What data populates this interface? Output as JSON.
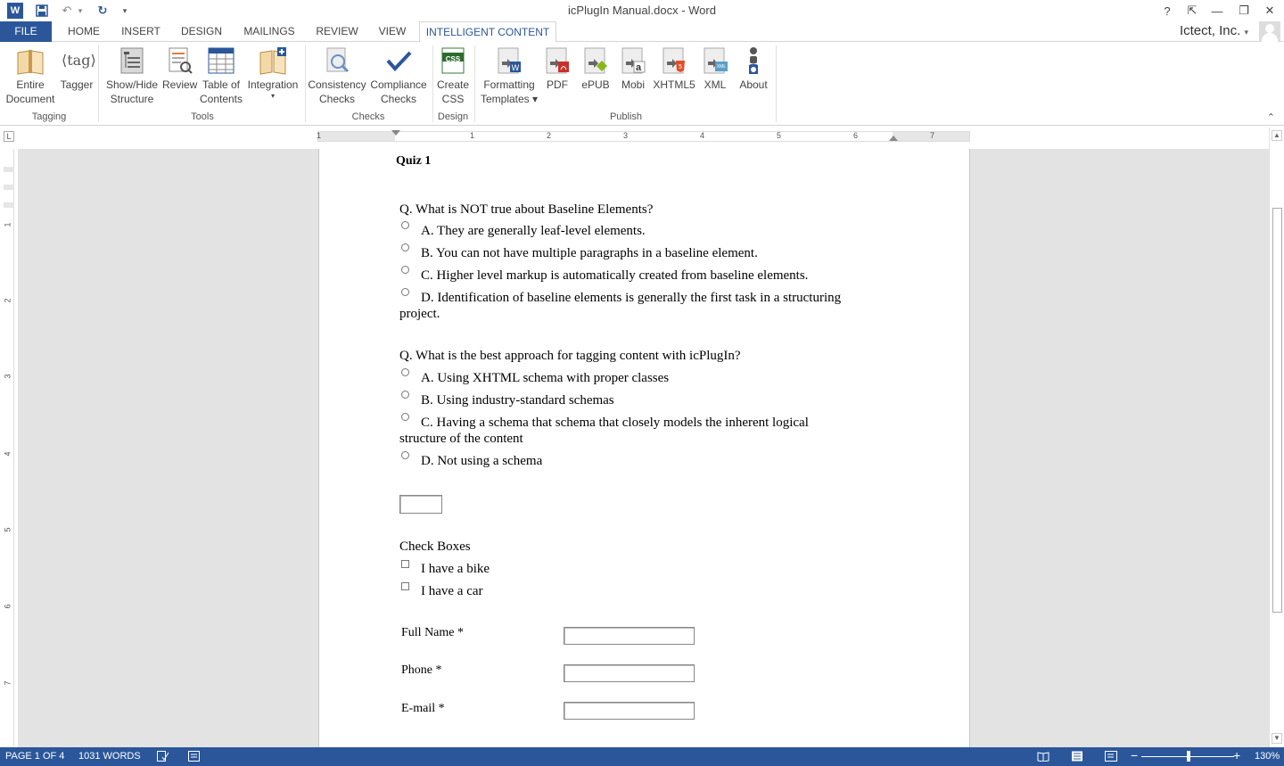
{
  "window": {
    "title": "icPlugIn Manual.docx - Word",
    "help": "?",
    "controls": {
      "restore_ribbon": "⇱",
      "minimize": "—",
      "maximize": "❐",
      "close": "✕"
    }
  },
  "quick_access": {
    "word_icon": "W",
    "save": "💾",
    "undo": "↶",
    "undo_drop": "▾",
    "redo": "↻",
    "customize": "▾"
  },
  "tabs": {
    "file": "FILE",
    "home": "HOME",
    "insert": "INSERT",
    "design": "DESIGN",
    "mailings": "MAILINGS",
    "review": "REVIEW",
    "view": "VIEW",
    "intelligent_content": "INTELLIGENT CONTENT"
  },
  "account": {
    "name": "Ictect, Inc.",
    "dropdown": "▾"
  },
  "ribbon": {
    "groups": {
      "tagging": "Tagging",
      "tools": "Tools",
      "checks": "Checks",
      "design": "Design",
      "publish": "Publish"
    },
    "buttons": {
      "entire_document_1": "Entire",
      "entire_document_2": "Document",
      "tagger": "Tagger",
      "show_hide_1": "Show/Hide",
      "show_hide_2": "Structure",
      "review": "Review",
      "toc_1": "Table of",
      "toc_2": "Contents",
      "integration": "Integration",
      "integration_drop": "▾",
      "consistency_1": "Consistency",
      "consistency_2": "Checks",
      "compliance_1": "Compliance",
      "compliance_2": "Checks",
      "create_css_1": "Create",
      "create_css_2": "CSS",
      "formatting_1": "Formatting",
      "formatting_2": "Templates ▾",
      "pdf": "PDF",
      "epub": "ePUB",
      "mobi": "Mobi",
      "xhtml5": "XHTML5",
      "xml": "XML",
      "about": "About"
    },
    "icons": {
      "tag_glyph": "⟨tag⟩",
      "css_glyph": "CSS",
      "a_glyph": "a",
      "xml_glyph": "XML"
    },
    "collapse": "⌃"
  },
  "ruler": {
    "corner": "L",
    "numbers": [
      "1",
      "1",
      "2",
      "3",
      "4",
      "5",
      "6",
      "7"
    ],
    "vertical_numbers": [
      "1",
      "2",
      "3",
      "4",
      "5",
      "6",
      "7"
    ]
  },
  "document": {
    "quiz_title": "Quiz 1",
    "q1": {
      "question": "Q. What is NOT true about Baseline Elements?",
      "a": "A. They are generally leaf-level elements.",
      "b": "B. You can not have multiple paragraphs in a baseline element.",
      "c": "C. Higher level markup is automatically created from baseline elements.",
      "d1": "D. Identification of baseline elements is generally the first task in a structuring",
      "d2": "project."
    },
    "q2": {
      "question": "Q. What is the best approach for tagging content with icPlugIn?",
      "a": "A. Using XHTML schema with proper classes",
      "b": "B. Using industry-standard schemas",
      "c1": "C. Having a schema that schema that closely models the inherent logical",
      "c2": "structure of the content",
      "d": "D. Not using a schema"
    },
    "checkboxes": {
      "heading": "Check Boxes",
      "bike": "I have a bike",
      "car": "I have a car"
    },
    "form": {
      "full_name": "Full Name *",
      "phone": "Phone *",
      "email": "E-mail *"
    }
  },
  "scrollbar": {
    "up": "▲",
    "down": "▼"
  },
  "status": {
    "page": "PAGE 1 OF 4",
    "words": "1031 WORDS",
    "zoom_minus": "−",
    "zoom_plus": "+",
    "zoom": "130%"
  }
}
